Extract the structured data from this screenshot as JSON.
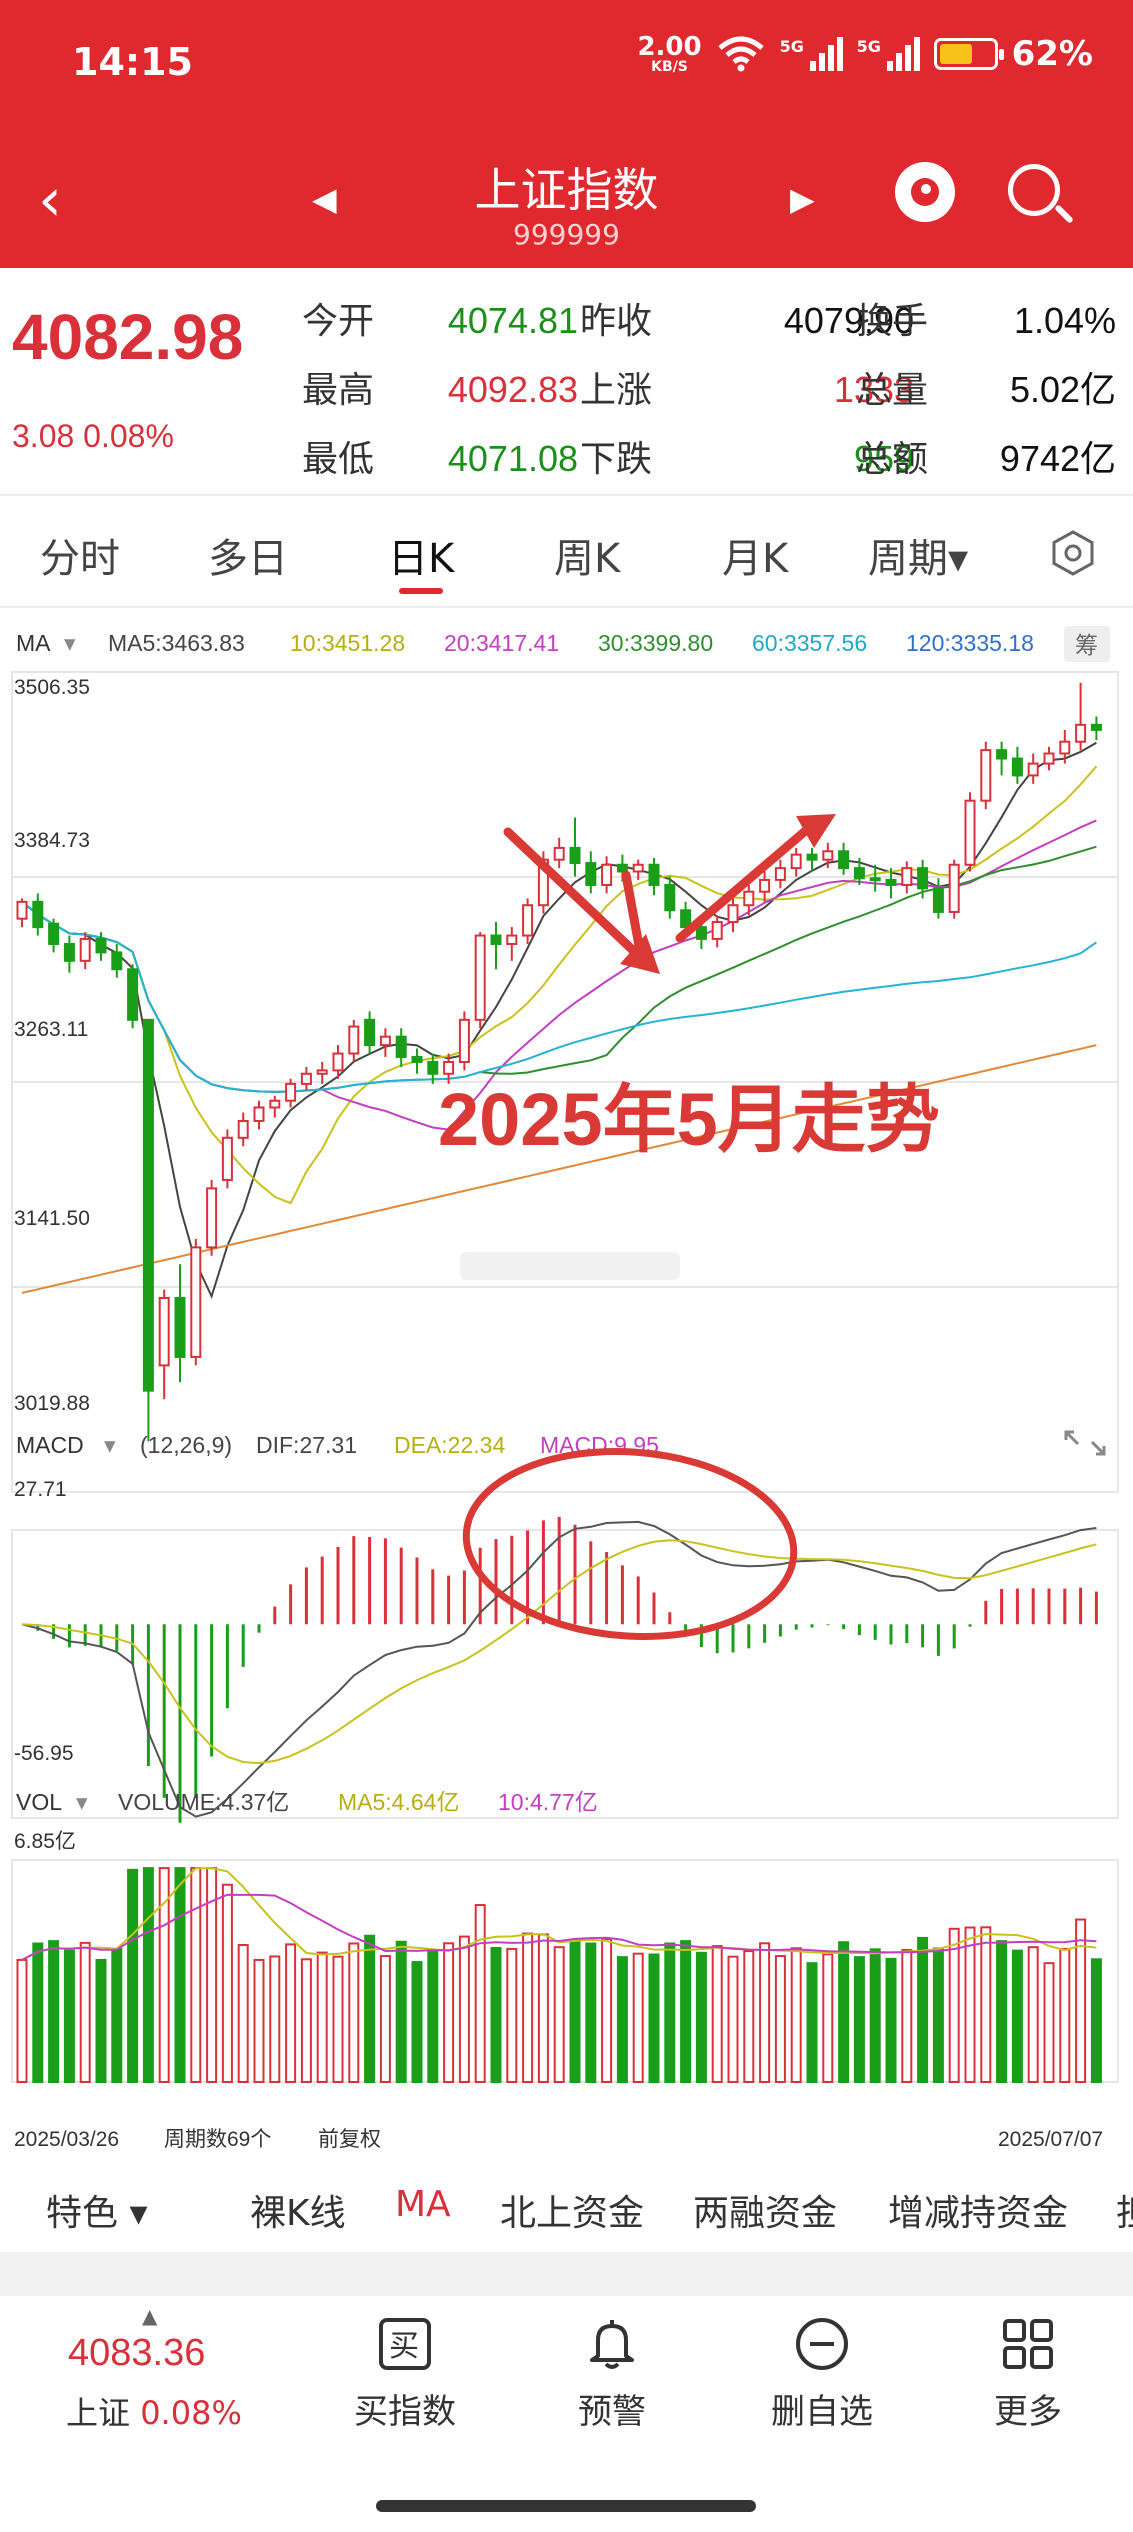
{
  "status_bar": {
    "time": "14:15",
    "net_speed": "2.00",
    "net_unit": "KB/S",
    "signal1": "5G",
    "signal2": "5G",
    "battery": "62%",
    "battery_level": 0.62
  },
  "header": {
    "title": "上证指数",
    "code": "999999"
  },
  "quote": {
    "price": "4082.98",
    "change": "3.08  0.08%",
    "rows": [
      {
        "l1": "今开",
        "v1": "4074.81",
        "l2": "昨收",
        "v2": "4079.90",
        "l3": "换手",
        "v3": "1.04%"
      },
      {
        "l1": "最高",
        "v1": "4092.83",
        "l2": "上涨",
        "v2": "1333",
        "l3": "总量",
        "v3": "5.02亿"
      },
      {
        "l1": "最低",
        "v1": "4071.08",
        "l2": "下跌",
        "v2": "959",
        "l3": "总额",
        "v3": "9742亿"
      }
    ]
  },
  "tabs": [
    "分时",
    "多日",
    "日K",
    "周K",
    "月K",
    "周期▾"
  ],
  "active_tab": "日K",
  "ma_legend": {
    "label": "MA",
    "ma5": "MA5:3463.83",
    "ma10": "10:3451.28",
    "ma20": "20:3417.41",
    "ma30": "30:3399.80",
    "ma60": "60:3357.56",
    "ma120": "120:3335.18",
    "badge": "筹"
  },
  "price_axis": [
    "3506.35",
    "3384.73",
    "3263.11",
    "3141.50",
    "3019.88"
  ],
  "annotation": "2025年5月走势",
  "macd_legend": {
    "label": "MACD",
    "params": "(12,26,9)",
    "dif": "DIF:27.31",
    "dea": "DEA:22.34",
    "macd": "MACD:9.95"
  },
  "macd_axis": [
    "27.71",
    "-56.95"
  ],
  "vol_legend": {
    "label": "VOL",
    "volume": "VOLUME:4.37亿",
    "ma5": "MA5:4.64亿",
    "ma10": "10:4.77亿"
  },
  "vol_axis": [
    "6.85亿"
  ],
  "x_axis": {
    "start": "2025/03/26",
    "count": "周期数69个",
    "adjust": "前复权",
    "end": "2025/07/07"
  },
  "colors": {
    "up": "#d9303a",
    "down": "#1a9e1a",
    "ma5": "#444444",
    "ma10": "#c9c21c",
    "ma20": "#c23fc2",
    "ma30": "#2f8f2f",
    "ma60": "#26b3d4",
    "ma120": "#2f6fd0",
    "annotation": "#d93a35"
  },
  "feature_bar": [
    "特色 ▾",
    "裸K线",
    "MA",
    "北上资金",
    "两融资金",
    "增减持资金",
    "担"
  ],
  "bottom_bar": {
    "price": "4083.36",
    "name": "上证",
    "pct": "0.08%",
    "buttons": [
      {
        "label": "买指数",
        "icon": "buy-icon",
        "glyph": "买"
      },
      {
        "label": "预警",
        "icon": "bell-icon"
      },
      {
        "label": "删自选",
        "icon": "minus-circle-icon"
      },
      {
        "label": "更多",
        "icon": "grid-icon"
      }
    ]
  },
  "chart_data": {
    "type": "candlestick",
    "ylim": [
      3019.88,
      3506.35
    ],
    "candles": [
      [
        3360,
        3370,
        3355,
        3372
      ],
      [
        3370,
        3355,
        3350,
        3375
      ],
      [
        3357,
        3345,
        3340,
        3360
      ],
      [
        3345,
        3335,
        3328,
        3350
      ],
      [
        3335,
        3348,
        3330,
        3352
      ],
      [
        3348,
        3340,
        3335,
        3352
      ],
      [
        3340,
        3330,
        3325,
        3345
      ],
      [
        3330,
        3300,
        3295,
        3333
      ],
      [
        3300,
        3080,
        3050,
        3135
      ],
      [
        3095,
        3135,
        3075,
        3140
      ],
      [
        3135,
        3100,
        3085,
        3155
      ],
      [
        3100,
        3165,
        3095,
        3170
      ],
      [
        3165,
        3200,
        3160,
        3205
      ],
      [
        3205,
        3230,
        3200,
        3235
      ],
      [
        3230,
        3240,
        3225,
        3245
      ],
      [
        3240,
        3248,
        3235,
        3252
      ],
      [
        3248,
        3252,
        3242,
        3255
      ],
      [
        3252,
        3262,
        3248,
        3265
      ],
      [
        3262,
        3268,
        3258,
        3272
      ],
      [
        3268,
        3270,
        3262,
        3275
      ],
      [
        3270,
        3280,
        3265,
        3285
      ],
      [
        3280,
        3296,
        3275,
        3300
      ],
      [
        3300,
        3285,
        3280,
        3305
      ],
      [
        3285,
        3290,
        3278,
        3295
      ],
      [
        3290,
        3278,
        3272,
        3295
      ],
      [
        3278,
        3275,
        3268,
        3283
      ],
      [
        3275,
        3268,
        3262,
        3280
      ],
      [
        3268,
        3275,
        3262,
        3280
      ],
      [
        3275,
        3300,
        3270,
        3305
      ],
      [
        3300,
        3350,
        3295,
        3352
      ],
      [
        3350,
        3345,
        3330,
        3358
      ],
      [
        3345,
        3350,
        3335,
        3355
      ],
      [
        3350,
        3368,
        3345,
        3372
      ],
      [
        3368,
        3395,
        3363,
        3400
      ],
      [
        3395,
        3402,
        3390,
        3408
      ],
      [
        3402,
        3393,
        3385,
        3420
      ],
      [
        3393,
        3380,
        3375,
        3400
      ],
      [
        3380,
        3392,
        3375,
        3397
      ],
      [
        3392,
        3388,
        3382,
        3398
      ],
      [
        3388,
        3392,
        3383,
        3395
      ],
      [
        3392,
        3380,
        3374,
        3396
      ],
      [
        3380,
        3365,
        3360,
        3385
      ],
      [
        3365,
        3355,
        3350,
        3370
      ],
      [
        3355,
        3348,
        3342,
        3362
      ],
      [
        3348,
        3358,
        3343,
        3362
      ],
      [
        3358,
        3368,
        3352,
        3372
      ],
      [
        3368,
        3376,
        3362,
        3380
      ],
      [
        3376,
        3383,
        3370,
        3388
      ],
      [
        3383,
        3390,
        3378,
        3395
      ],
      [
        3390,
        3398,
        3385,
        3402
      ],
      [
        3398,
        3395,
        3388,
        3402
      ],
      [
        3395,
        3400,
        3390,
        3405
      ],
      [
        3400,
        3390,
        3386,
        3405
      ],
      [
        3390,
        3384,
        3380,
        3396
      ],
      [
        3384,
        3383,
        3376,
        3392
      ],
      [
        3383,
        3380,
        3372,
        3390
      ],
      [
        3380,
        3390,
        3375,
        3394
      ],
      [
        3390,
        3378,
        3372,
        3395
      ],
      [
        3378,
        3364,
        3360,
        3384
      ],
      [
        3364,
        3392,
        3360,
        3395
      ],
      [
        3392,
        3430,
        3388,
        3435
      ],
      [
        3430,
        3460,
        3425,
        3465
      ],
      [
        3460,
        3455,
        3445,
        3465
      ],
      [
        3455,
        3445,
        3440,
        3462
      ],
      [
        3445,
        3452,
        3440,
        3458
      ],
      [
        3452,
        3458,
        3448,
        3462
      ],
      [
        3458,
        3465,
        3452,
        3472
      ],
      [
        3465,
        3475,
        3460,
        3500
      ],
      [
        3475,
        3472,
        3466,
        3480
      ]
    ]
  }
}
